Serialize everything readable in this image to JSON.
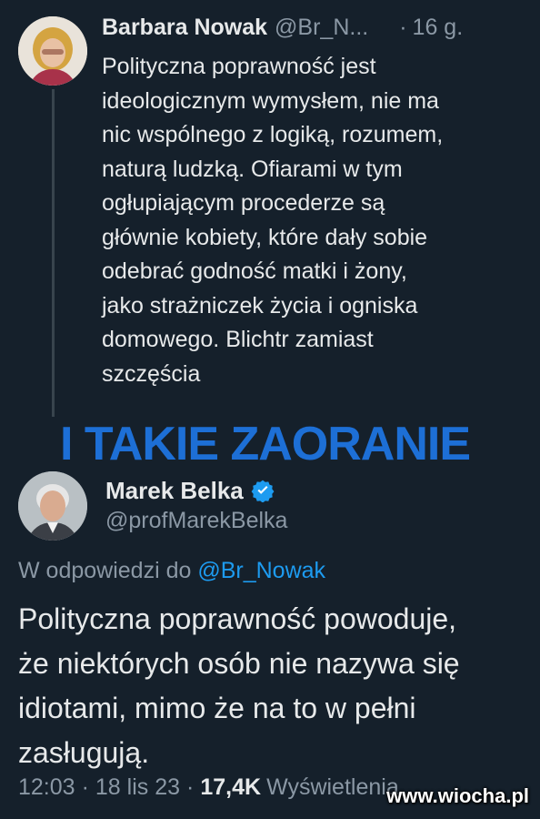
{
  "tweet1": {
    "author_name": "Barbara Nowak",
    "handle": "@Br_N...",
    "separator": "·",
    "time": "16 g.",
    "body_lines": [
      "Polityczna poprawność jest",
      "ideologicznym wymysłem, nie ma",
      "nic wspólnego z logiką, rozumem,",
      "naturą ludzką. Ofiarami w tym",
      "ogłupiającym procederze są",
      "głównie kobiety, które dały sobie",
      "odebrać godność matki i żony,",
      "jako strażniczek życia i ogniska",
      "domowego. Blichtr zamiast",
      "szczęścia"
    ]
  },
  "banner": {
    "text": "I TAKIE ZAORANIE",
    "color": "#1d6fd6"
  },
  "tweet2": {
    "author_name": "Marek Belka",
    "verified_icon": "verified-badge-icon",
    "handle": "@profMarekBelka",
    "reply_prefix": "W odpowiedzi do",
    "reply_mention": "@Br_Nowak",
    "body_lines": [
      "Polityczna poprawność powoduje,",
      "że niektórych osób nie nazywa się",
      "idiotami, mimo że na to w pełni",
      "zasługują."
    ],
    "time": "12:03",
    "date": "18 lis 23",
    "separator": "·",
    "views_count": "17,4K",
    "views_label": "Wyświetlenia"
  },
  "watermark": "www.wiocha.pl",
  "colors": {
    "background": "#15202b",
    "primary_text": "#e7e9ea",
    "secondary_text": "#8b98a5",
    "link": "#1d9bf0"
  }
}
